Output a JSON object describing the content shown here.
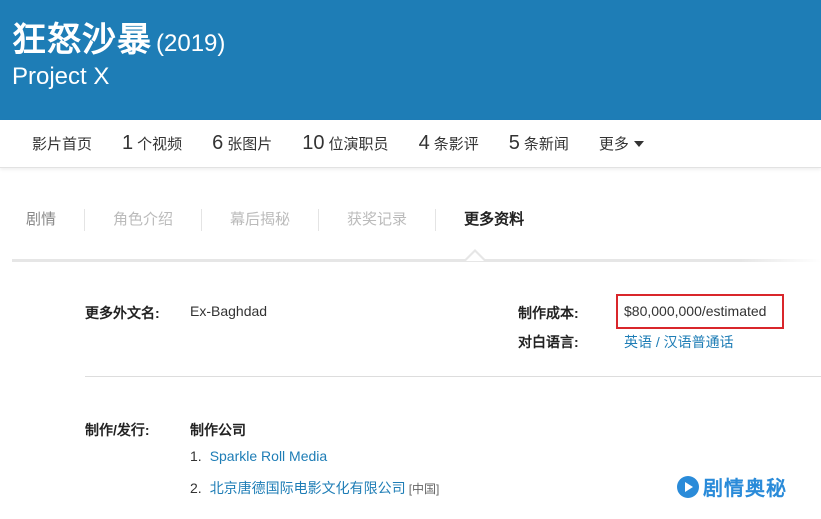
{
  "header": {
    "title_cn": "狂怒沙暴",
    "year": "(2019)",
    "title_en": "Project X"
  },
  "nav": {
    "home": "影片首页",
    "items": [
      {
        "num": "1",
        "label": "个视频"
      },
      {
        "num": "6",
        "label": "张图片"
      },
      {
        "num": "10",
        "label": "位演职员"
      },
      {
        "num": "4",
        "label": "条影评"
      },
      {
        "num": "5",
        "label": "条新闻"
      }
    ],
    "more": "更多"
  },
  "subtabs": [
    "剧情",
    "角色介绍",
    "幕后揭秘",
    "获奖记录",
    "更多资料"
  ],
  "details": {
    "aka_label": "更多外文名:",
    "aka_value": "Ex-Baghdad",
    "budget_label": "制作成本:",
    "budget_value": "$80,000,000/estimated",
    "language_label": "对白语言:",
    "language_value": "英语 / 汉语普通话",
    "production_label": "制作/发行:",
    "company_heading": "制作公司",
    "companies": [
      {
        "num": "1.",
        "name": "Sparkle Roll Media",
        "region": ""
      },
      {
        "num": "2.",
        "name": "北京唐德国际电影文化有限公司",
        "region": "[中国]"
      }
    ]
  },
  "watermark": "剧情奥秘",
  "colors": {
    "header_bg": "#1e7db6",
    "link": "#1e7db6",
    "highlight_box": "#d9262b"
  }
}
